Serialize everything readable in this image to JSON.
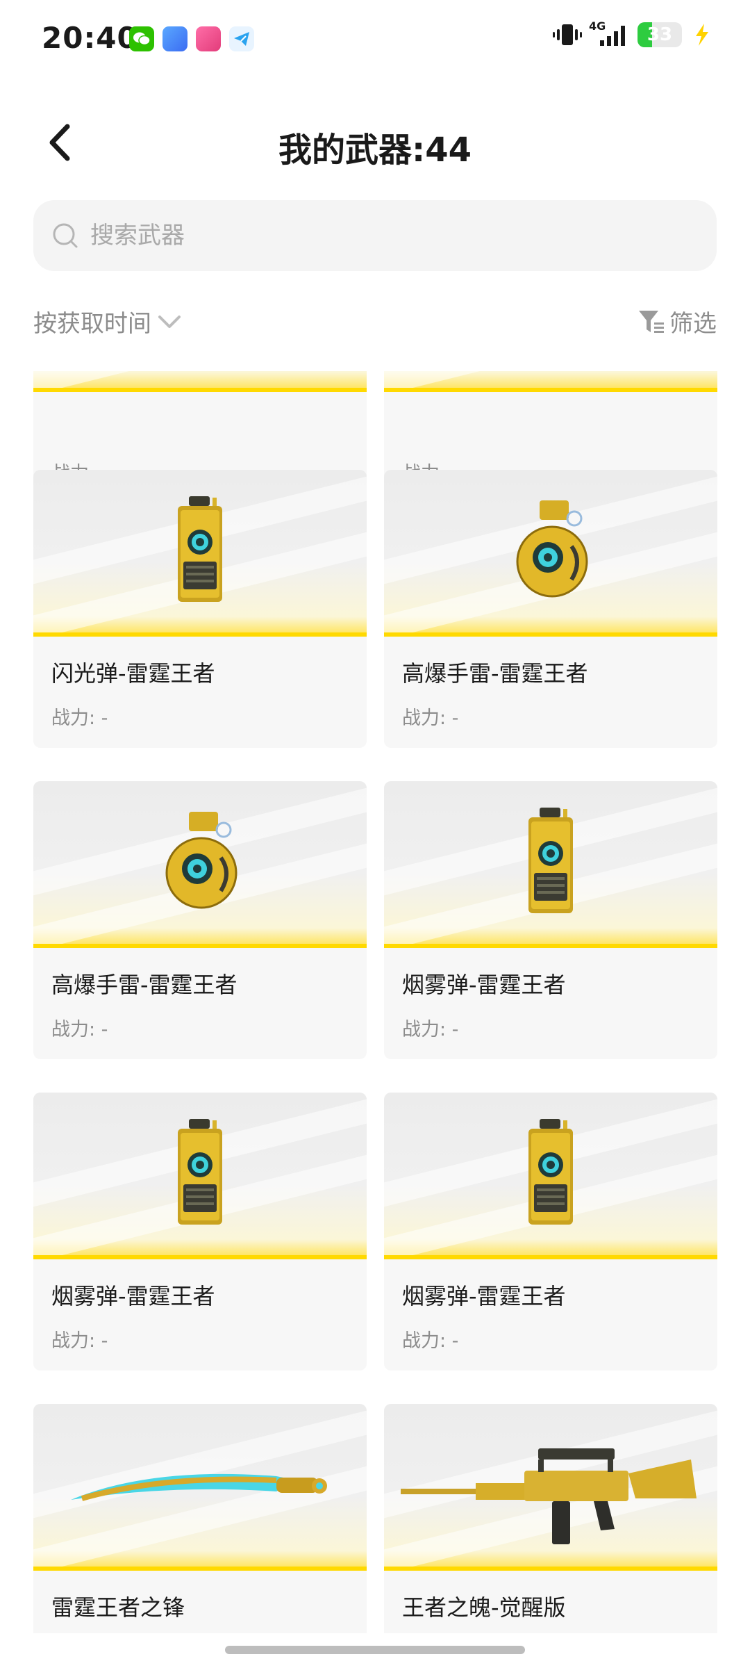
{
  "status_bar": {
    "time": "20:40",
    "network": "4G",
    "battery": "33",
    "battery_level": 0.33,
    "app_icons": [
      "wechat-icon",
      "app-icon-blue",
      "app-icon-pink",
      "telegram-icon"
    ]
  },
  "header": {
    "title": "我的武器:44"
  },
  "search": {
    "placeholder": "搜索武器"
  },
  "toolbar": {
    "sort_label": "按获取时间",
    "filter_label": "筛选"
  },
  "weapons": [
    {
      "name": "",
      "power": "战力: -",
      "image": "partial-card"
    },
    {
      "name": "",
      "power": "战力: -",
      "image": "partial-card"
    },
    {
      "name": "闪光弹-雷霆王者",
      "power": "战力: -",
      "image": "flashbang-canister"
    },
    {
      "name": "高爆手雷-雷霆王者",
      "power": "战力: -",
      "image": "frag-grenade"
    },
    {
      "name": "高爆手雷-雷霆王者",
      "power": "战力: -",
      "image": "frag-grenade"
    },
    {
      "name": "烟雾弹-雷霆王者",
      "power": "战力: -",
      "image": "smoke-canister"
    },
    {
      "name": "烟雾弹-雷霆王者",
      "power": "战力: -",
      "image": "smoke-canister"
    },
    {
      "name": "烟雾弹-雷霆王者",
      "power": "战力: -",
      "image": "smoke-canister"
    },
    {
      "name": "雷霆王者之锋",
      "power": "",
      "image": "golden-blade"
    },
    {
      "name": "王者之魄-觉醒版",
      "power": "",
      "image": "golden-rifle"
    }
  ],
  "colors": {
    "accent": "#ffd900",
    "card_bg": "#f7f7f7",
    "muted_text": "#8c8c8c"
  }
}
